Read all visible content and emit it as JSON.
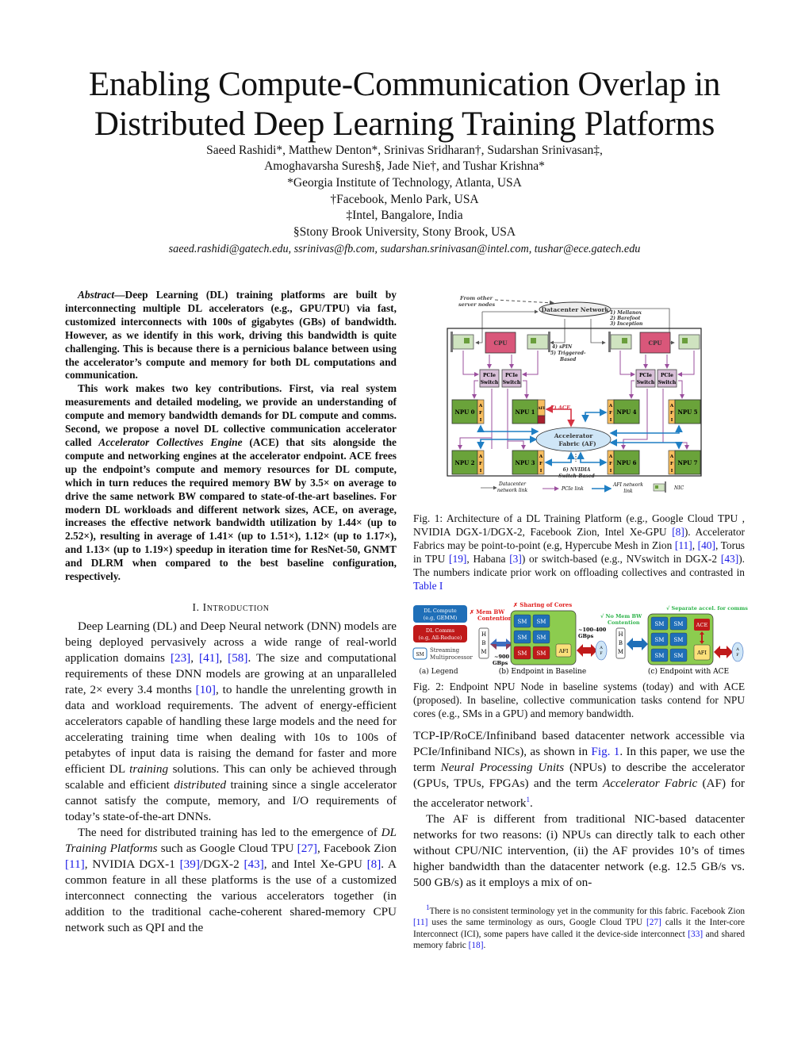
{
  "title": {
    "line1": "Enabling Compute-Communication Overlap in",
    "line2": "Distributed Deep Learning Training Platforms"
  },
  "authors": {
    "line1": "Saeed Rashidi*, Matthew Denton*, Srinivas Sridharan†, Sudarshan Srinivasan‡,",
    "line2": "Amoghavarsha Suresh§, Jade Nie†, and Tushar Krishna*",
    "affiliations": [
      "*Georgia Institute of Technology, Atlanta, USA",
      "†Facebook, Menlo Park, USA",
      "‡Intel, Bangalore, India",
      "§Stony Brook University, Stony Brook, USA"
    ],
    "emails": "saeed.rashidi@gatech.edu, ssrinivas@fb.com, sudarshan.srinivasan@intel.com, tushar@ece.gatech.edu"
  },
  "abstract": {
    "label": "Abstract",
    "p1": "—Deep Learning (DL) training platforms are built by interconnecting multiple DL accelerators (e.g., GPU/TPU) via fast, customized interconnects with 100s of gigabytes (GBs) of bandwidth. However, as we identify in this work, driving this bandwidth is quite challenging. This is because there is a pernicious balance between using the accelerator’s compute and memory for both DL computations and communication.",
    "p2a": "This work makes two key contributions. First, via real system measurements and detailed modeling, we provide an understanding of compute and memory bandwidth demands for DL compute and comms. Second, we propose a novel DL collective communication accelerator called ",
    "p2_ital": "Accelerator Collectives Engine",
    "p2b": " (ACE) that sits alongside the compute and networking engines at the accelerator endpoint. ACE frees up the endpoint’s compute and memory resources for DL compute, which in turn reduces the required memory BW by 3.5× on average to drive the same network BW compared to state-of-the-art baselines. For modern DL workloads and different network sizes, ACE, on average, increases the effective network bandwidth utilization by 1.44× (up to 2.52×), resulting in average of 1.41× (up to 1.51×), 1.12× (up to 1.17×), and 1.13× (up to 1.19×) speedup in iteration time for ResNet-50, GNMT and DLRM when compared to the best baseline configuration, respectively."
  },
  "section1": {
    "number": "I.",
    "title": "Introduction",
    "p1": [
      {
        "t": "Deep Learning (DL) and Deep Neural network (DNN) models are being deployed pervasively across a wide range of real-world application domains "
      },
      {
        "c": "[23]"
      },
      {
        "t": ", "
      },
      {
        "c": "[41]"
      },
      {
        "t": ", "
      },
      {
        "c": "[58]"
      },
      {
        "t": ". The size and computational requirements of these DNN models are growing at an unparalleled rate, 2× every 3.4 months "
      },
      {
        "c": "[10]"
      },
      {
        "t": ", to handle the unrelenting growth in data and workload requirements. The advent of energy-efficient accelerators capable of handling these large models and the need for accelerating training time when dealing with 10s to 100s of petabytes of input data is raising the demand for faster and more efficient DL "
      },
      {
        "i": "training"
      },
      {
        "t": " solutions. This can only be achieved through scalable and efficient "
      },
      {
        "i": "distributed"
      },
      {
        "t": " training since a single accelerator cannot satisfy the compute, memory, and I/O requirements of today’s state-of-the-art DNNs."
      }
    ],
    "p2": [
      {
        "t": "The need for distributed training has led to the emergence of "
      },
      {
        "i": "DL Training Platforms"
      },
      {
        "t": " such as Google Cloud TPU "
      },
      {
        "c": "[27]"
      },
      {
        "t": ", Facebook Zion "
      },
      {
        "c": "[11]"
      },
      {
        "t": ", NVIDIA DGX-1 "
      },
      {
        "c": "[39]"
      },
      {
        "t": "/DGX-2 "
      },
      {
        "c": "[43]"
      },
      {
        "t": ", and Intel Xe-GPU "
      },
      {
        "c": "[8]"
      },
      {
        "t": ". A common feature in all these platforms is the use of a customized interconnect connecting the various accelerators together (in addition to the traditional cache-coherent shared-memory CPU network such as QPI and the"
      }
    ]
  },
  "right_col": {
    "p1": [
      {
        "t": "TCP-IP/RoCE/Infiniband based datacenter network accessible via PCIe/Infiniband NICs), as shown in "
      },
      {
        "c": "Fig. 1"
      },
      {
        "t": ". In this paper, we use the term "
      },
      {
        "i": "Neural Processing Units"
      },
      {
        "t": " (NPUs) to describe the accelerator (GPUs, TPUs, FPGAs) and the term "
      },
      {
        "i": "Accelerator Fabric"
      },
      {
        "t": " (AF) for the accelerator network"
      },
      {
        "sup": "1"
      },
      {
        "t": "."
      }
    ],
    "p2": "The AF is different from traditional NIC-based datacenter networks for two reasons: (i) NPUs can directly talk to each other without CPU/NIC intervention, (ii) the AF provides 10’s of times higher bandwidth than the datacenter network (e.g. 12.5 GB/s vs. 500 GB/s) as it employs a mix of on-"
  },
  "footnote": [
    {
      "sup": "1"
    },
    {
      "t": "There is no consistent terminology yet in the community for this fabric. Facebook Zion "
    },
    {
      "c": "[11]"
    },
    {
      "t": " uses the same terminology as ours, Google Cloud TPU "
    },
    {
      "c": "[27]"
    },
    {
      "t": " calls it the Inter-core Interconnect (ICI), some papers have called it the device-side interconnect "
    },
    {
      "c": "[33]"
    },
    {
      "t": " and shared memory fabric "
    },
    {
      "c": "[18]"
    },
    {
      "t": "."
    }
  ],
  "fig1": {
    "caption": [
      {
        "t": "Fig. 1: Architecture of a DL Training Platform (e.g., Google Cloud TPU , NVIDIA DGX-1/DGX-2, Facebook Zion, Intel Xe-GPU "
      },
      {
        "c": "[8]"
      },
      {
        "t": "). Accelerator Fabrics may be point-to-point (e.g, Hypercube Mesh in Zion "
      },
      {
        "c": "[11]"
      },
      {
        "t": ", "
      },
      {
        "c": "[40]"
      },
      {
        "t": ", Torus in TPU "
      },
      {
        "c": "[19]"
      },
      {
        "t": ", Habana "
      },
      {
        "c": "[3]"
      },
      {
        "t": ") or switch-based (e.g., NVswitch in DGX-2 "
      },
      {
        "c": "[43]"
      },
      {
        "t": "). The numbers indicate prior work on offloading collectives and contrasted in "
      },
      {
        "c": "Table I"
      }
    ],
    "from_other_1": "From other",
    "from_other_2": "server nodes",
    "datacenter_network": "Datacenter Network",
    "prior_work_top": [
      "1) Mellanox",
      "2) Barefoot",
      "3) Inception"
    ],
    "prior_work_mid": [
      "4) sPIN",
      "5) Triggered-",
      "Based"
    ],
    "cpu": "CPU",
    "pcie": "PCIe",
    "switch": "Switch",
    "npus": [
      "NPU 0",
      "NPU 1",
      "NPU 2",
      "NPU 3",
      "NPU 4",
      "NPU 5",
      "NPU 6",
      "NPU 7"
    ],
    "afi": [
      "A",
      "F",
      "I"
    ],
    "afi_short": "AFI",
    "ace_label": "7) ACE",
    "af_1": "Accelerator",
    "af_2": "Fabric (AF)",
    "nvidia_1": "6) NVIDIA",
    "nvidia_2": "Switch-Based",
    "legend": {
      "dc_1": "Datacenter",
      "dc_2": "network link",
      "pcie": "PCIe link",
      "afi_1": "AFI network",
      "afi_2": "link",
      "nic": "NIC"
    },
    "colors": {
      "cpu": "#d9577a",
      "npu": "#6aa33a",
      "afi": "#f7bd5e",
      "pcie_switch": "#d8bfd8",
      "pcie_link": "#9b4f9e",
      "afi_link": "#1f7fc4",
      "ace": "#d63343",
      "cloud": "#cfe6f7"
    }
  },
  "fig2": {
    "caption": "Fig. 2: Endpoint NPU Node in baseline systems (today) and with ACE (proposed). In baseline, collective communication tasks contend for NPU cores (e.g., SMs in a GPU) and memory bandwidth.",
    "legend_compute_1": "DL Compute",
    "legend_compute_2": "(e.g, GEMM)",
    "legend_comms_1": "DL Comms",
    "legend_comms_2": "(e.g, All-Reduce)",
    "sm": "SM",
    "sm_desc_1": "Streaming",
    "sm_desc_2": "Multiprocessor",
    "mem_bw_1": "✗ Mem BW",
    "mem_bw_2": "Contention",
    "sharing": "✗ Sharing of Cores",
    "hbm": [
      "H",
      "B",
      "M"
    ],
    "bw_900_1": "~900",
    "bw_900_2": "GBps",
    "bw_100_1": "~100-400",
    "bw_100_2": "GBps",
    "afi": "AFI",
    "af": [
      "A",
      "F"
    ],
    "no_mem_1": "√ No Mem BW",
    "no_mem_2": "Contention",
    "separate": "√ Separate accel. for comms",
    "ace": "ACE",
    "sub_a": "(a) Legend",
    "sub_b": "(b) Endpoint in Baseline",
    "sub_c": "(c) Endpoint with ACE",
    "colors": {
      "compute": "#1f6fb8",
      "comms": "#c01a1a",
      "node": "#8ccc4f",
      "afi": "#fbe07a",
      "cross": "#e0201f",
      "check": "#2db34a"
    }
  }
}
